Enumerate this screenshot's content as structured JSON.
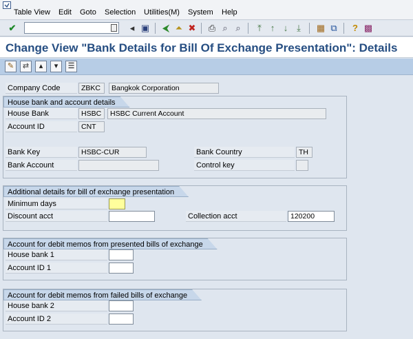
{
  "menu": {
    "items": [
      "Table View",
      "Edit",
      "Goto",
      "Selection",
      "Utilities(M)",
      "System",
      "Help"
    ]
  },
  "toolbar": {
    "command_field_value": "",
    "icons": [
      "enter-icon",
      "save-icon",
      "back-icon",
      "exit-icon",
      "cancel-icon",
      "print-icon",
      "find-icon",
      "find-next-icon",
      "first-page-icon",
      "previous-page-icon",
      "next-page-icon",
      "last-page-icon",
      "new-session-icon",
      "shortcut-icon",
      "help-icon",
      "customize-layout-icon"
    ]
  },
  "title": "Change View \"Bank Details for Bill Of Exchange Presentation\": Details",
  "app_toolbar": {
    "icons": [
      "change-display-icon",
      "other-entry-icon",
      "previous-entry-icon",
      "next-entry-icon",
      "variable-list-icon"
    ]
  },
  "company": {
    "label": "Company Code",
    "code": "ZBKC",
    "name": "Bangkok Corporation"
  },
  "house_bank_group": {
    "title": "House bank and account details",
    "house_bank_label": "House Bank",
    "house_bank_value": "HSBC",
    "house_bank_desc": "HSBC Current Account",
    "account_id_label": "Account ID",
    "account_id_value": "CNT",
    "bank_key_label": "Bank Key",
    "bank_key_value": "HSBC-CUR",
    "bank_account_label": "Bank Account",
    "bank_account_value": "",
    "bank_country_label": "Bank Country",
    "bank_country_value": "TH",
    "control_key_label": "Control key",
    "control_key_value": ""
  },
  "additional_group": {
    "title": "Additional details for bill of exchange presentation",
    "min_days_label": "Minimum days",
    "min_days_value": "",
    "discount_label": "Discount acct",
    "discount_value": "",
    "collection_label": "Collection acct",
    "collection_value": "120200"
  },
  "presented_group": {
    "title": "Account for debit memos from presented bills of exchange",
    "house_bank_label": "House bank 1",
    "house_bank_value": "",
    "account_id_label": "Account ID 1",
    "account_id_value": ""
  },
  "failed_group": {
    "title": "Account for debit memos from failed bills of exchange",
    "house_bank_label": "House bank 2",
    "house_bank_value": "",
    "account_id_label": "Account ID 2",
    "account_id_value": ""
  },
  "colors": {
    "title": "#264e82",
    "focused_field": "#ffff9c",
    "background": "#dfe6ef"
  }
}
